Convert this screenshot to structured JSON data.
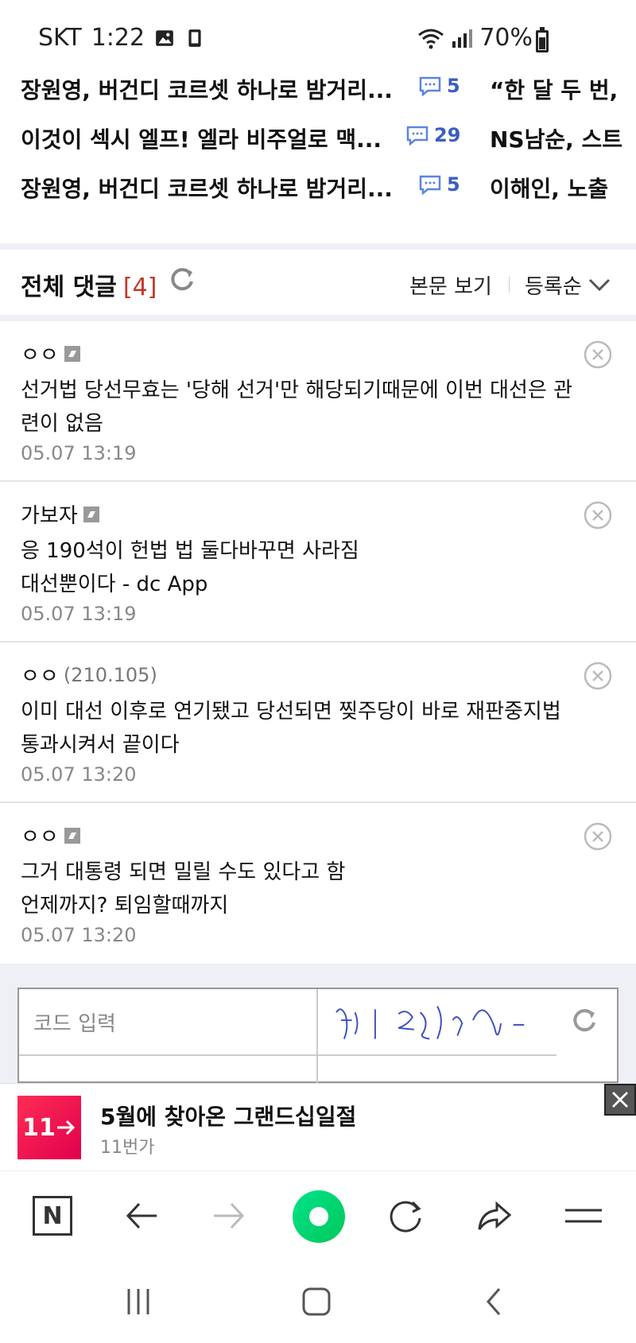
{
  "status_bar": {
    "carrier": "SKT",
    "time": "1:22",
    "battery": "70%"
  },
  "news": [
    {
      "title": "장원영, 버건디 코르셋 하나로 밤거리...",
      "comments": "5",
      "right_title": "“한 달 두 번,"
    },
    {
      "title": "이것이 섹시 엘프! 엘라 비주얼로 맥...",
      "comments": "29",
      "right_title": "NS남순, 스트"
    },
    {
      "title": "장원영, 버건디 코르셋 하나로 밤거리...",
      "comments": "5",
      "right_title": "이해인, 노출"
    }
  ],
  "comments_header": {
    "title": "전체 댓글",
    "count": "[4]",
    "view_body": "본문 보기",
    "sort": "등록순"
  },
  "comments": [
    {
      "author": "ㅇㅇ",
      "ip": "",
      "fixed": true,
      "lines": [
        "선거법 당선무효는 '당해 선거'만 해당되기때문에 이번 대선은 관",
        "련이 없음"
      ],
      "date": "05.07 13:19"
    },
    {
      "author": "가보자",
      "ip": "",
      "fixed": true,
      "lines": [
        "응 190석이 헌법 법 둘다바꾸면 사라짐",
        "대선뿐이다 - dc App"
      ],
      "date": "05.07 13:19"
    },
    {
      "author": "ㅇㅇ",
      "ip": "(210.105)",
      "fixed": false,
      "lines": [
        "이미 대선 이후로 연기됐고 당선되면 찢주당이 바로 재판중지법",
        "통과시켜서 끝이다"
      ],
      "date": "05.07 13:20"
    },
    {
      "author": "ㅇㅇ",
      "ip": "",
      "fixed": true,
      "lines": [
        "그거 대통령 되면 밀릴 수도 있다고 함",
        "언제까지? 퇴임할때까지"
      ],
      "date": "05.07 13:20"
    }
  ],
  "captcha": {
    "placeholder": "코드 입력"
  },
  "ad": {
    "logo": "11",
    "title": "5월에 찾아온 그랜드십일절",
    "subtitle": "11번가"
  },
  "toolbar": {
    "home_label": "N"
  }
}
